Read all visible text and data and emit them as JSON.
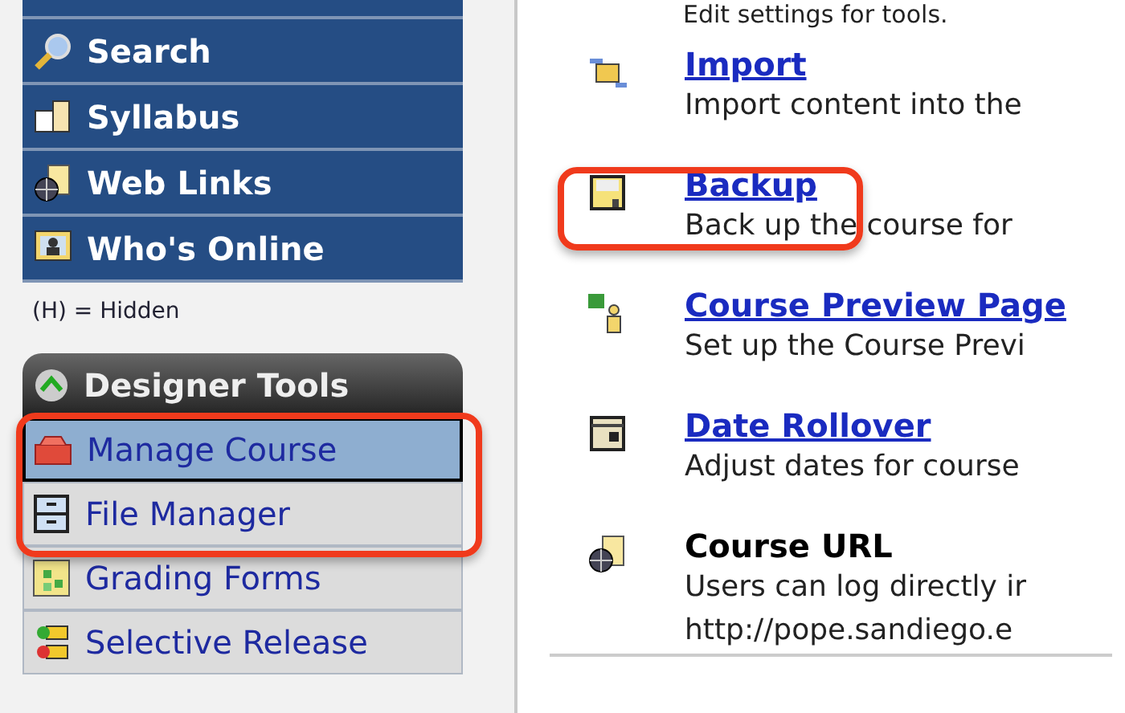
{
  "sidebar": {
    "nav_items": [
      {
        "label": "Search"
      },
      {
        "label": "Syllabus"
      },
      {
        "label": "Web Links"
      },
      {
        "label": "Who's Online"
      }
    ],
    "legend": "(H) = Hidden",
    "designer_tools": {
      "title": "Designer Tools",
      "expanded": true,
      "items": [
        {
          "label": "Manage Course",
          "selected": true
        },
        {
          "label": "File Manager",
          "selected": false
        },
        {
          "label": "Grading Forms",
          "selected": false
        },
        {
          "label": "Selective Release",
          "selected": false
        }
      ]
    }
  },
  "content": {
    "top_description": "Edit settings for tools.",
    "tools": [
      {
        "title": "Import",
        "link": true,
        "description": [
          "Import content into the"
        ]
      },
      {
        "title": "Backup",
        "link": true,
        "description": [
          "Back up the course for"
        ]
      },
      {
        "title": "Course Preview Page",
        "link": true,
        "description": [
          "Set up the Course Previ"
        ]
      },
      {
        "title": "Date Rollover",
        "link": true,
        "description": [
          "Adjust dates for course"
        ]
      },
      {
        "title": "Course URL",
        "link": false,
        "description": [
          "Users can log directly ir",
          "http://pope.sandiego.e"
        ]
      }
    ]
  }
}
